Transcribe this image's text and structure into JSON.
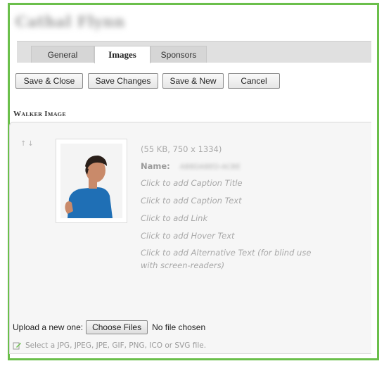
{
  "page_title": "Cathal Flynn",
  "tabs": [
    {
      "label": "General",
      "active": false
    },
    {
      "label": "Images",
      "active": true
    },
    {
      "label": "Sponsors",
      "active": false
    }
  ],
  "toolbar": {
    "save_close": "Save & Close",
    "save_changes": "Save Changes",
    "save_new": "Save & New",
    "cancel": "Cancel"
  },
  "section": {
    "title": "Walker Image"
  },
  "image": {
    "info": "(55 KB, 750 x 1334)",
    "name_label": "Name:",
    "name_value": "ABBDABED-ACBE",
    "caption_title": "Click to add Caption Title",
    "caption_text": "Click to add Caption Text",
    "link": "Click to add Link",
    "hover_text": "Click to add Hover Text",
    "alt_text_line1": "Click to add Alternative Text (for blind use",
    "alt_text_line2": "with screen-readers)"
  },
  "upload": {
    "label": "Upload a new one:",
    "button": "Choose Files",
    "status": "No file chosen",
    "hint": "Select a JPG, JPEG, JPE, GIF, PNG, ICO or SVG file."
  },
  "colors": {
    "frame_border": "#6bbf4b",
    "shirt": "#1f6fb5",
    "skin": "#c98a6a",
    "hair": "#2a1f1a"
  }
}
